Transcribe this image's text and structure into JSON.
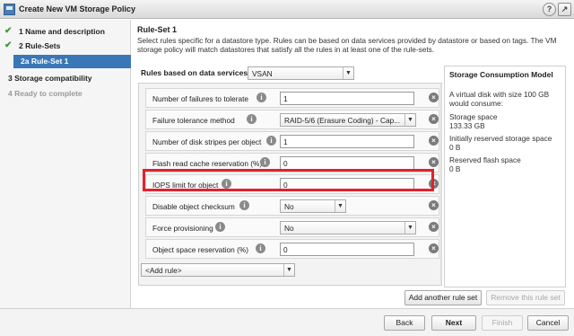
{
  "window": {
    "title": "Create New VM Storage Policy",
    "help_glyph": "?"
  },
  "nav": {
    "steps": [
      {
        "label": "1  Name and description",
        "status": "complete"
      },
      {
        "label": "2  Rule-Sets",
        "status": "complete"
      },
      {
        "label": "2a  Rule-Set 1",
        "status": "active"
      },
      {
        "label": "3  Storage compatibility",
        "status": "pending"
      },
      {
        "label": "4  Ready to complete",
        "status": "disabled"
      }
    ]
  },
  "header": {
    "title": "Rule-Set 1",
    "description": "Select rules specific for a datastore type. Rules can be based on data services provided by datastore or based on tags. The VM storage policy will match datastores that satisfy all the rules in at least one of the rule-sets."
  },
  "rules": {
    "label": "Rules based on data services",
    "data_service": "VSAN",
    "rows": [
      {
        "label": "Number of failures to tolerate",
        "value": "1",
        "type": "text"
      },
      {
        "label": "Failure tolerance method",
        "value": "RAID-5/6 (Erasure Coding) - Cap...",
        "type": "select"
      },
      {
        "label": "Number of disk stripes per object",
        "value": "1",
        "type": "text"
      },
      {
        "label": "Flash read cache reservation (%)",
        "value": "0",
        "type": "text"
      },
      {
        "label": "IOPS limit for object",
        "value": "0",
        "type": "text"
      },
      {
        "label": "Disable object checksum",
        "value": "No",
        "type": "select"
      },
      {
        "label": "Force provisioning",
        "value": "No",
        "type": "select"
      },
      {
        "label": "Object space reservation (%)",
        "value": "0",
        "type": "text"
      }
    ],
    "add_rule": "<Add rule>"
  },
  "consumption": {
    "title": "Storage Consumption Model",
    "intro": "A virtual disk with size 100 GB would consume:",
    "storage_space_label": "Storage space",
    "storage_space_value": "133.33 GB",
    "reserved_storage_label": "Initially reserved storage space",
    "reserved_storage_value": "0 B",
    "reserved_flash_label": "Reserved flash space",
    "reserved_flash_value": "0 B"
  },
  "ruleset_actions": {
    "add": "Add another rule set",
    "remove": "Remove this rule set"
  },
  "footer": {
    "back": "Back",
    "next": "Next",
    "finish": "Finish",
    "cancel": "Cancel"
  },
  "colors": {
    "highlight": "#e0222c",
    "active_step": "#3a77b7",
    "check": "#3a9a3a"
  }
}
